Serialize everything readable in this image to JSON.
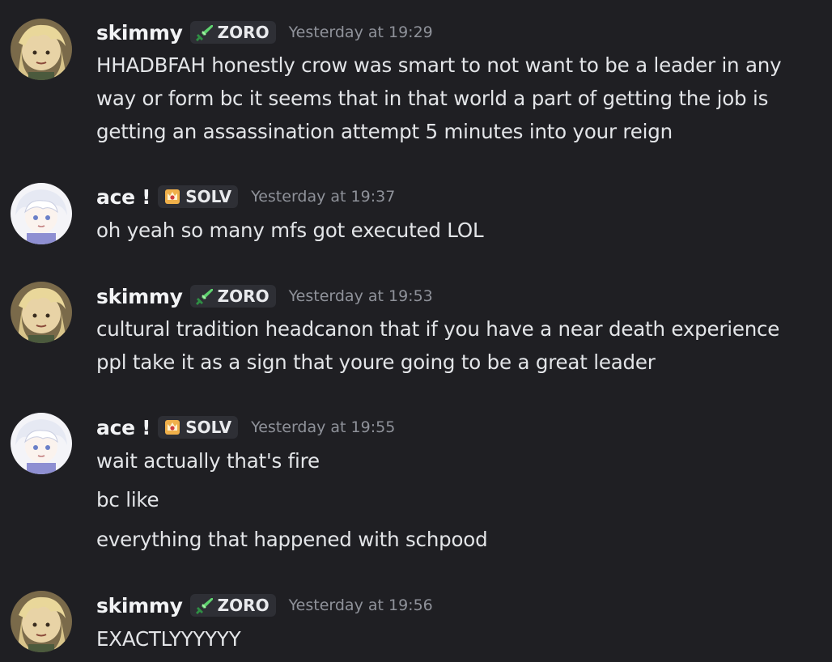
{
  "messages": [
    {
      "author": "skimmy",
      "avatar_icon": "blonde-character-avatar",
      "tag_icon": "sword-icon",
      "tag": "ZORO",
      "tag_color": "#3ba55d",
      "timestamp": "Yesterday at 19:29",
      "lines": [
        "HHADBFAH honestly crow was smart to not want to be a leader in any",
        "way or form bc it seems that in that world a part of getting the job is",
        "getting an assassination attempt 5 minutes into your reign"
      ]
    },
    {
      "author": "ace !",
      "avatar_icon": "white-haired-character-avatar",
      "tag_icon": "crown-badge-icon",
      "tag": "SOLV",
      "tag_color": "#e8a33d",
      "timestamp": "Yesterday at 19:37",
      "lines": [
        "oh yeah so many mfs got executed LOL"
      ]
    },
    {
      "author": "skimmy",
      "avatar_icon": "blonde-character-avatar",
      "tag_icon": "sword-icon",
      "tag": "ZORO",
      "tag_color": "#3ba55d",
      "timestamp": "Yesterday at 19:53",
      "lines": [
        "cultural tradition headcanon that if you have a near death experience",
        "ppl take it as a sign that youre going to be a great leader"
      ]
    },
    {
      "author": "ace !",
      "avatar_icon": "white-haired-character-avatar",
      "tag_icon": "crown-badge-icon",
      "tag": "SOLV",
      "tag_color": "#e8a33d",
      "timestamp": "Yesterday at 19:55",
      "lines": [
        "wait actually that's fire",
        "bc like",
        "everything that happened with schpood"
      ]
    },
    {
      "author": "skimmy",
      "avatar_icon": "blonde-character-avatar",
      "tag_icon": "sword-icon",
      "tag": "ZORO",
      "tag_color": "#3ba55d",
      "timestamp": "Yesterday at 19:56",
      "lines": [
        "EXACTLYYYYYY"
      ]
    }
  ]
}
